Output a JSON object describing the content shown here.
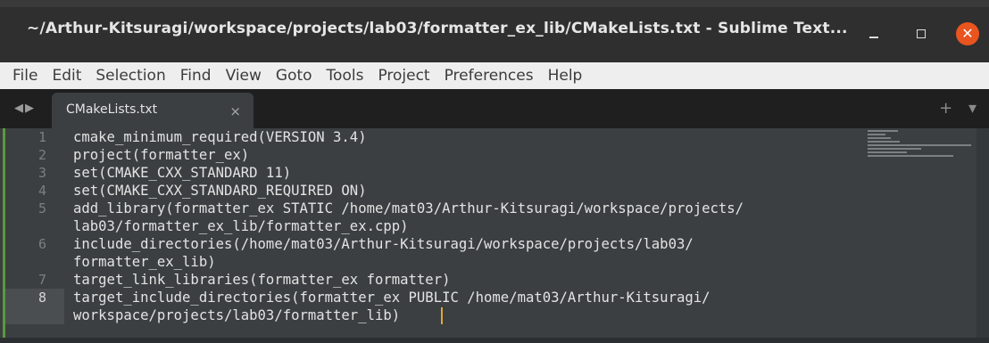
{
  "window": {
    "title": "~/Arthur-Kitsuragi/workspace/projects/lab03/formatter_ex_lib/CMakeLists.txt - Sublime Text...",
    "minimize_icon": "minimize-icon",
    "maximize_icon": "maximize-icon",
    "close_icon": "close-icon",
    "close_color": "#e9541f"
  },
  "menubar": {
    "items": [
      "File",
      "Edit",
      "Selection",
      "Find",
      "View",
      "Goto",
      "Tools",
      "Project",
      "Preferences",
      "Help"
    ]
  },
  "tabbar": {
    "nav_icon": "tab-nav-arrows-icon",
    "active_tab": {
      "label": "CMakeLists.txt",
      "close_glyph": "×"
    },
    "actions_glyph": "+ ▾"
  },
  "editor": {
    "active_line": 8,
    "line_numbers": [
      "1",
      "2",
      "3",
      "4",
      "5",
      "6",
      "7",
      "8"
    ],
    "code_lines": [
      "cmake_minimum_required(VERSION 3.4)",
      "project(formatter_ex)",
      "set(CMAKE_CXX_STANDARD 11)",
      "set(CMAKE_CXX_STANDARD_REQUIRED ON)",
      "add_library(formatter_ex STATIC /home/mat03/Arthur-Kitsuragi/workspace/projects/",
      "lab03/formatter_ex_lib/formatter_ex.cpp)",
      "include_directories(/home/mat03/Arthur-Kitsuragi/workspace/projects/lab03/",
      "formatter_ex_lib)",
      "target_link_libraries(formatter_ex formatter)",
      "target_include_directories(formatter_ex PUBLIC /home/mat03/Arthur-Kitsuragi/",
      "workspace/projects/lab03/formatter_lib)"
    ],
    "colors": {
      "background": "#3b3f41",
      "text": "#e3e3e3",
      "line_number": "#7b7f81",
      "cursor": "#e0a43a",
      "modified_marker": "#5a9a3e"
    }
  }
}
